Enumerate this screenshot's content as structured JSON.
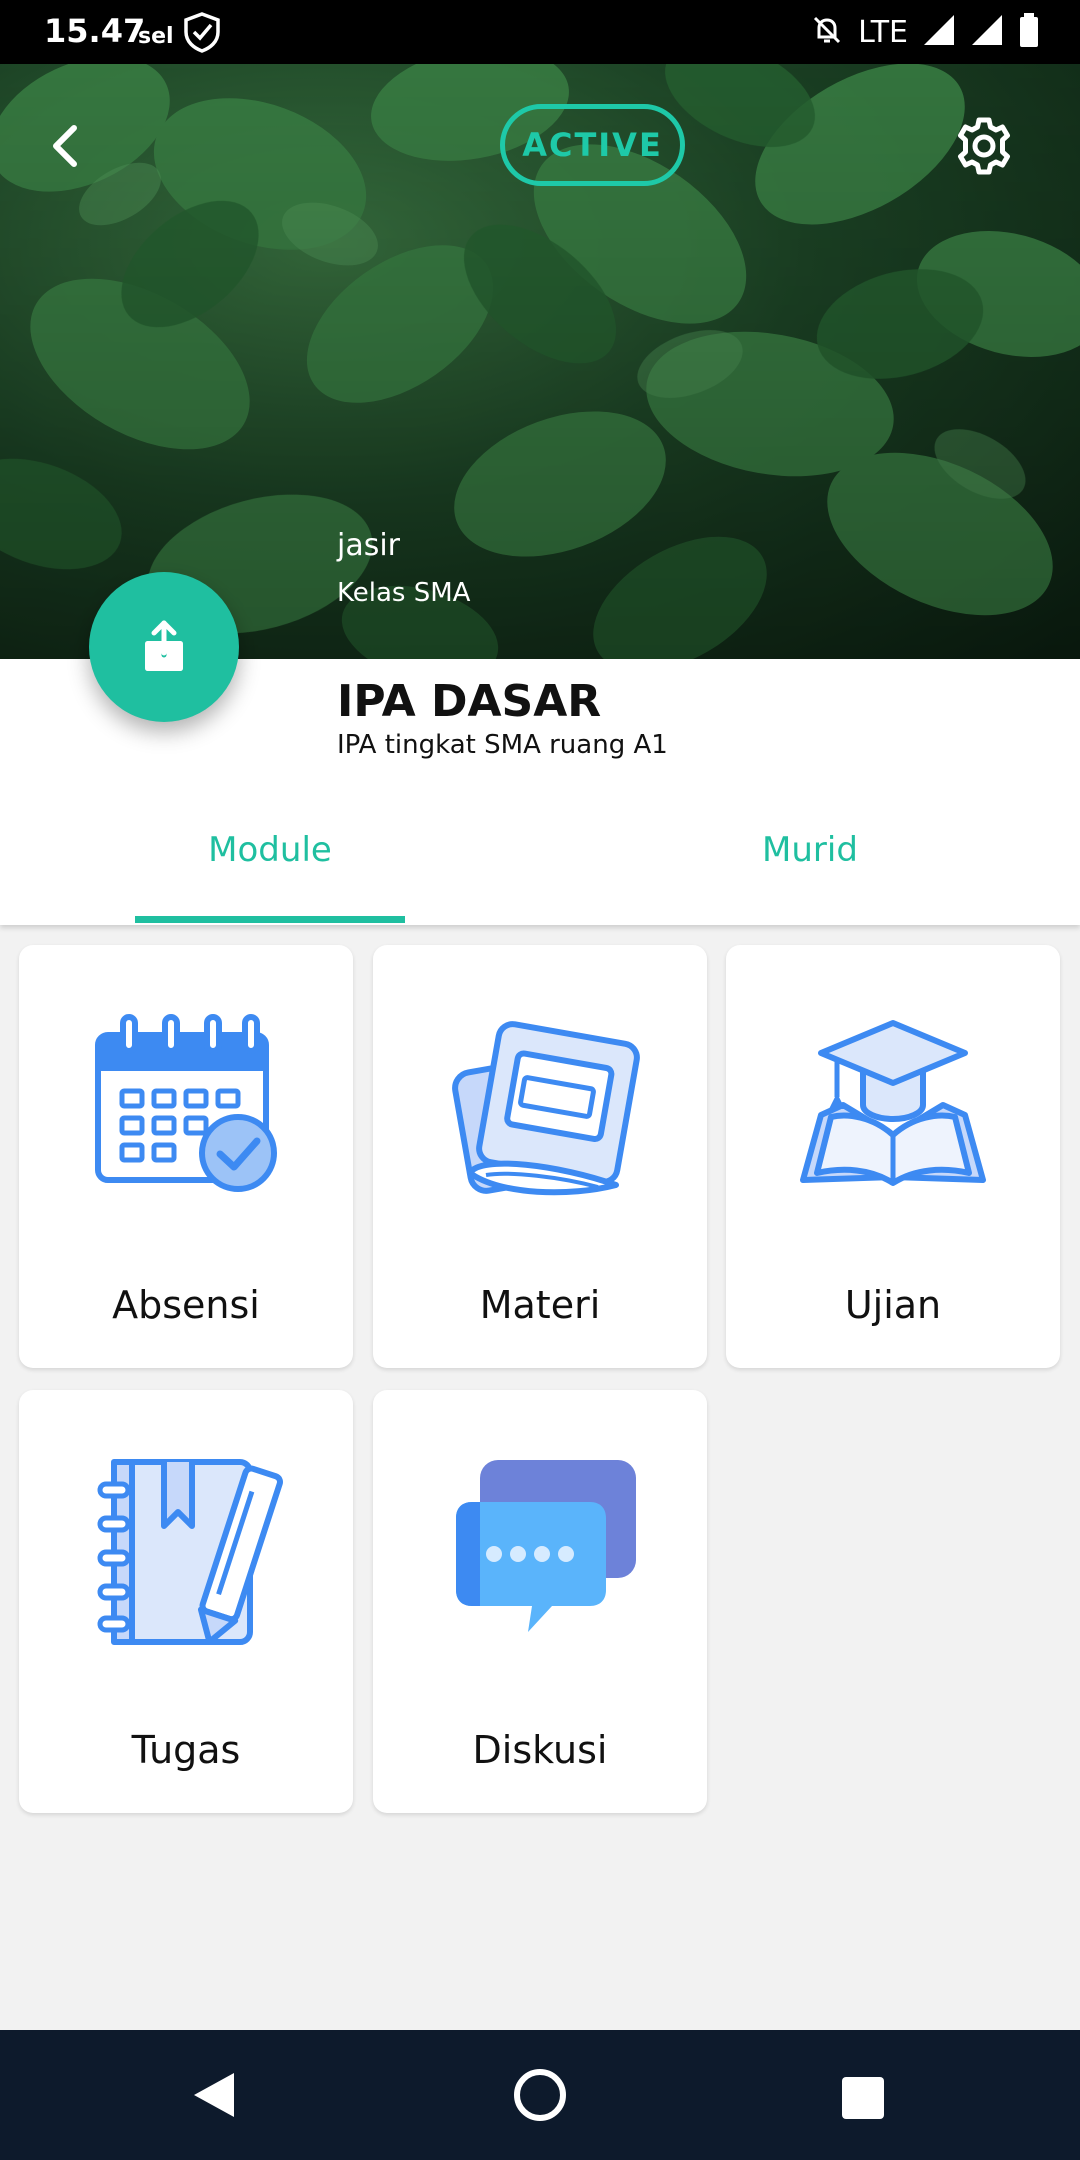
{
  "status_bar": {
    "time": "15.47",
    "day": "sel",
    "network": "LTE"
  },
  "header": {
    "status_badge": "ACTIVE",
    "owner": "jasir",
    "class_level": "Kelas SMA"
  },
  "class_info": {
    "title": "IPA DASAR",
    "description": "IPA tingkat SMA ruang A1"
  },
  "tabs": [
    {
      "label": "Module",
      "selected": true
    },
    {
      "label": "Murid",
      "selected": false
    }
  ],
  "modules": [
    {
      "label": "Absensi",
      "icon": "calendar-check-icon"
    },
    {
      "label": "Materi",
      "icon": "books-icon"
    },
    {
      "label": "Ujian",
      "icon": "graduation-book-icon"
    },
    {
      "label": "Tugas",
      "icon": "notebook-pencil-icon"
    },
    {
      "label": "Diskusi",
      "icon": "chat-bubbles-icon"
    }
  ],
  "colors": {
    "accent": "#1fbfa0",
    "icon_blue": "#3d8af2",
    "icon_light": "#dbe7fb",
    "nav_bar": "#0d1a2c"
  }
}
